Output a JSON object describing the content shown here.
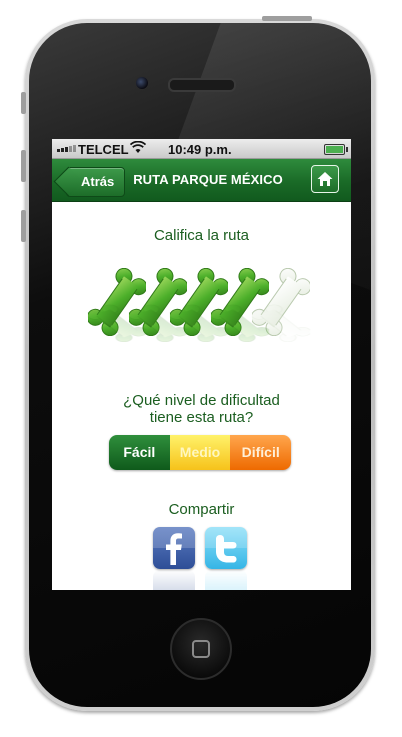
{
  "status_bar": {
    "carrier": "TELCEL",
    "time": "10:49 p.m.",
    "wifi_icon": "wifi-icon",
    "battery_icon": "battery-icon"
  },
  "nav": {
    "back_label": "Atrás",
    "title": "RUTA PARQUE MÉXICO",
    "home_icon": "home-icon"
  },
  "rating": {
    "label": "Califica la ruta",
    "value": 4,
    "max": 5,
    "icon": "bone-icon",
    "filled_color": "#4caf2a",
    "empty_color": "#e6ede0"
  },
  "difficulty": {
    "question_line1": "¿Qué nivel de dificultad",
    "question_line2": "tiene esta ruta?",
    "options": [
      "Fácil",
      "Medio",
      "Difícil"
    ],
    "selected": "Fácil",
    "colors": {
      "facil": "#1e7a2e",
      "medio": "#f9d63a",
      "dificil": "#f28a1e"
    }
  },
  "share": {
    "label": "Compartir",
    "buttons": [
      {
        "name": "facebook",
        "glyph": "f",
        "icon": "facebook-icon",
        "color": "#3b5998"
      },
      {
        "name": "twitter",
        "glyph": "t",
        "icon": "twitter-icon",
        "color": "#4cc4ef"
      }
    ]
  },
  "brand_color": "#1a6a27"
}
